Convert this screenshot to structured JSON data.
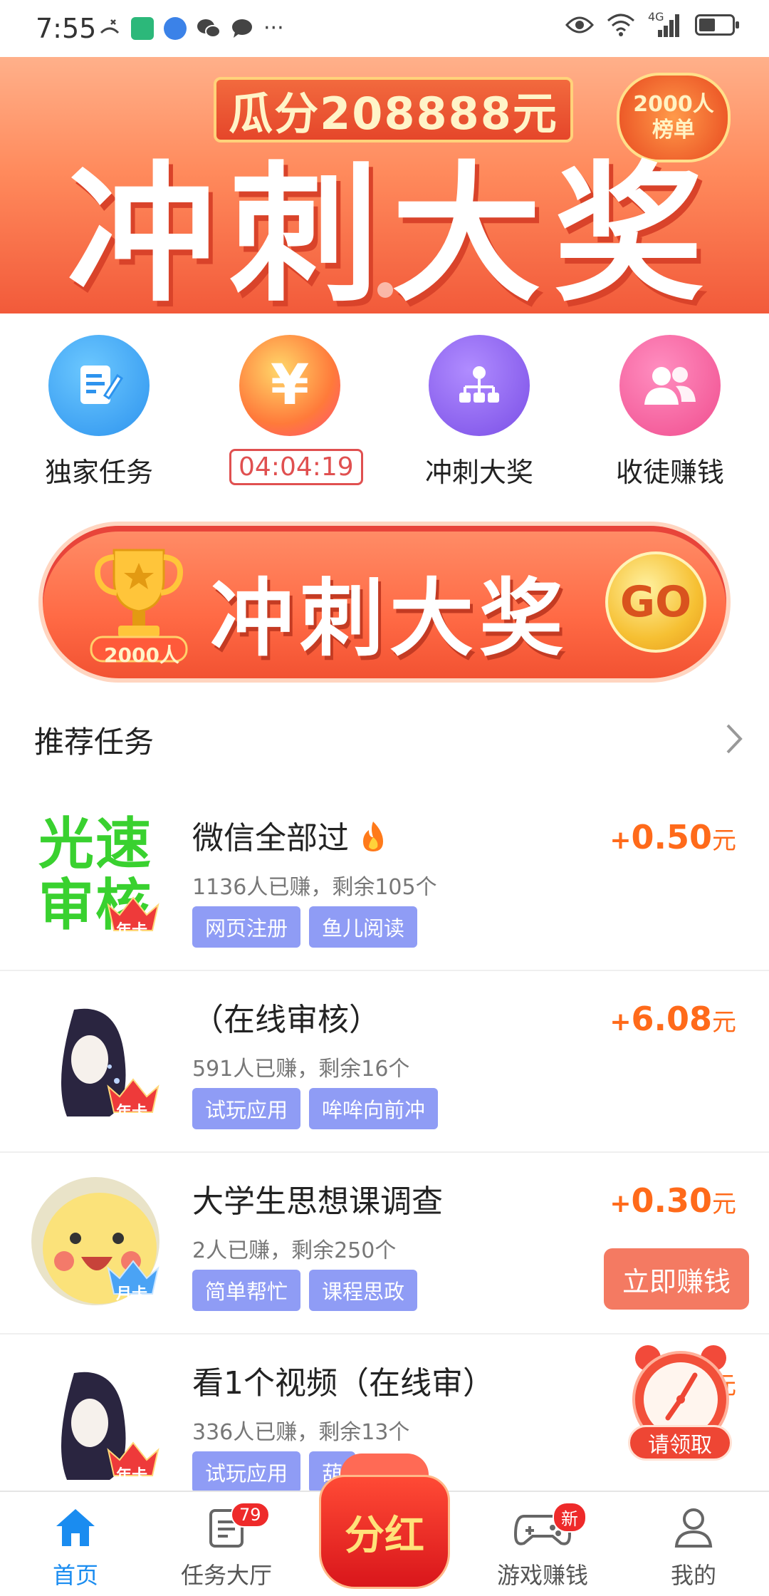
{
  "status_bar": {
    "time": "7:55",
    "network": "4G"
  },
  "banner": {
    "top_text": "瓜分208888元",
    "title": "冲刺大奖",
    "flame_line1": "2000人",
    "flame_line2": "榜单",
    "slides": 2,
    "active_slide": 1
  },
  "quick_actions": [
    {
      "label": "独家任务",
      "icon": "edit-icon",
      "color": "#3aa6f5"
    },
    {
      "label": "04:04:19",
      "icon": "yuan-icon",
      "color": "#ff8a3a"
    },
    {
      "label": "冲刺大奖",
      "icon": "flowchart-icon",
      "color": "#8a5cf0"
    },
    {
      "label": "收徒赚钱",
      "icon": "users-icon",
      "color": "#f2508c"
    }
  ],
  "sprint_banner": {
    "title": "冲刺大奖",
    "go_label": "GO",
    "trophy_label": "2000人"
  },
  "section": {
    "title": "推荐任务"
  },
  "tasks": [
    {
      "name": "微信全部过",
      "meta": "1136人已赚，剩余105个",
      "tags": [
        "网页注册",
        "鱼儿阅读"
      ],
      "price_plus": "+",
      "price": "0.50",
      "unit": "元",
      "badge": "年卡",
      "avatar_text": "光速审核"
    },
    {
      "name": "（在线审核）",
      "meta": "591人已赚，剩余16个",
      "tags": [
        "试玩应用",
        "哞哞向前冲"
      ],
      "price_plus": "+",
      "price": "6.08",
      "unit": "元",
      "badge": "年卡"
    },
    {
      "name": "大学生思想课调查",
      "meta": "2人已赚，剩余250个",
      "tags": [
        "简单帮忙",
        "课程思政"
      ],
      "price_plus": "+",
      "price": "0.30",
      "unit": "元",
      "badge": "月卡"
    },
    {
      "name": "看1个视频（在线审）",
      "meta": "336人已赚，剩余13个",
      "tags": [
        "试玩应用",
        "葫"
      ],
      "price_plus": "+",
      "price": "",
      "unit": "元",
      "badge": "年卡"
    }
  ],
  "earn_button": "立即赚钱",
  "claim_button": "请领取",
  "bottom_nav": {
    "items": [
      {
        "label": "首页",
        "icon": "home-icon",
        "badge": ""
      },
      {
        "label": "任务大厅",
        "icon": "task-list-icon",
        "badge": "79"
      },
      {
        "label": "游戏赚钱",
        "icon": "gamepad-icon",
        "badge": "新"
      },
      {
        "label": "我的",
        "icon": "user-icon",
        "badge": ""
      }
    ],
    "center_label": "分红"
  },
  "colors": {
    "accent": "#1a8cf0",
    "price": "#ff6a1a",
    "tag": "#8f9cf5"
  }
}
